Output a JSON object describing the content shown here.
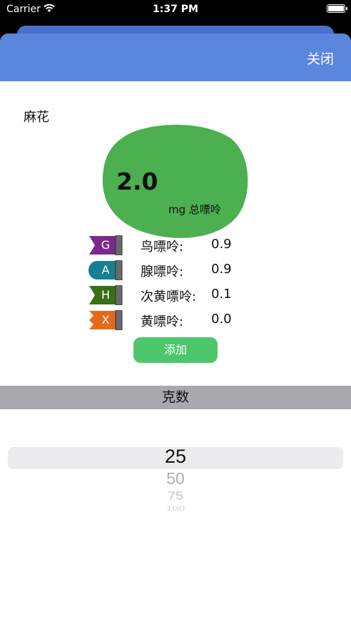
{
  "status_bar": {
    "carrier": "Carrier",
    "time": "1:37 PM"
  },
  "header": {
    "close_label": "关闭",
    "accent": "#5b86dd"
  },
  "food": {
    "name": "麻花",
    "total_value": "2.0",
    "total_unit": "mg 总嘌呤",
    "blob_color": "#4caf50"
  },
  "purines": [
    {
      "letter": "G",
      "name": "鸟嘌呤:",
      "value": "0.9",
      "color": "#7b2a8c",
      "shape": "chevron"
    },
    {
      "letter": "A",
      "name": "腺嘌呤:",
      "value": "0.9",
      "color": "#167f93",
      "shape": "rounded"
    },
    {
      "letter": "H",
      "name": "次黄嘌呤:",
      "value": "0.1",
      "color": "#386f17",
      "shape": "chevron"
    },
    {
      "letter": "X",
      "name": "黄嘌呤:",
      "value": "0.0",
      "color": "#e6691a",
      "shape": "notch"
    }
  ],
  "add_button": {
    "label": "添加",
    "color": "#4cc76c"
  },
  "section": {
    "title": "克数"
  },
  "picker": {
    "options": [
      "25",
      "50",
      "75",
      "100"
    ],
    "selected": "25"
  }
}
